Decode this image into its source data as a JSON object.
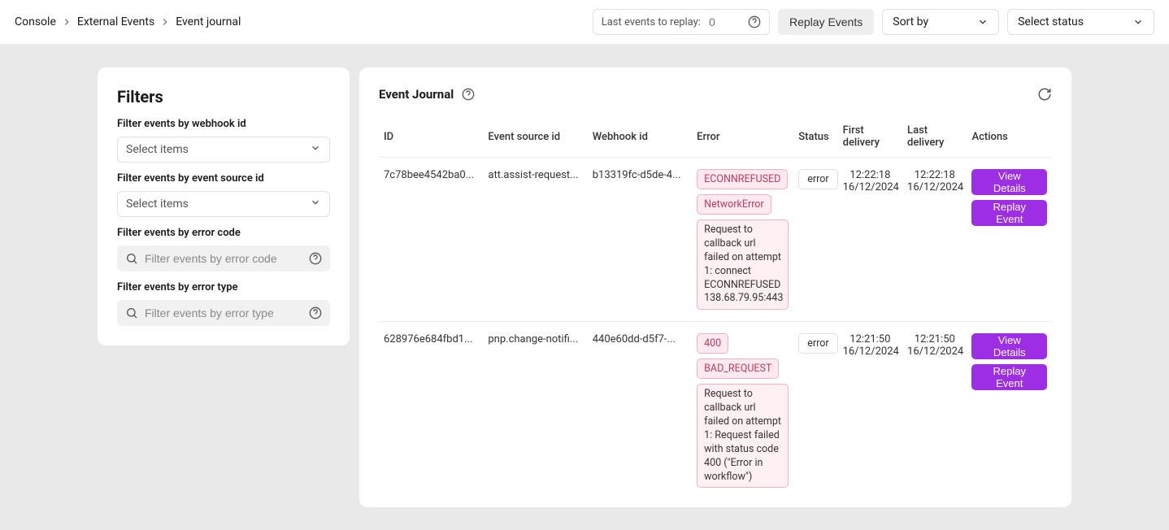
{
  "breadcrumbs": [
    "Console",
    "External Events",
    "Event journal"
  ],
  "topbar": {
    "replay_label": "Last events to replay:",
    "replay_value": "0",
    "replay_button": "Replay Events",
    "sort_by": "Sort by",
    "select_status": "Select status"
  },
  "filters": {
    "title": "Filters",
    "webhook_label": "Filter events by webhook id",
    "source_label": "Filter events by event source id",
    "error_code_label": "Filter events by error code",
    "error_type_label": "Filter events by error type",
    "select_items": "Select items",
    "error_code_placeholder": "Filter events by error code",
    "error_type_placeholder": "Filter events by error type"
  },
  "journal": {
    "title": "Event Journal",
    "columns": {
      "id": "ID",
      "source": "Event source id",
      "webhook": "Webhook id",
      "error": "Error",
      "status": "Status",
      "first": "First delivery",
      "last": "Last delivery",
      "actions": "Actions"
    },
    "rows": [
      {
        "id": "7c78bee4542ba0...",
        "source": "att.assist-request...",
        "webhook": "b13319fc-d5de-4...",
        "errors": [
          {
            "kind": "code",
            "text": "ECONNREFUSED"
          },
          {
            "kind": "code",
            "text": "NetworkError"
          },
          {
            "kind": "msg",
            "text": "Request to callback url failed on attempt 1: connect ECONNREFUSED 138.68.79.95:443"
          }
        ],
        "status": "error",
        "first": "12:22:18\n16/12/2024",
        "last": "12:22:18\n16/12/2024"
      },
      {
        "id": "628976e684fbd1...",
        "source": "pnp.change-notifi...",
        "webhook": "440e60dd-d5f7-...",
        "errors": [
          {
            "kind": "code",
            "text": "400"
          },
          {
            "kind": "code",
            "text": "BAD_REQUEST"
          },
          {
            "kind": "msg",
            "text": "Request to callback url failed on attempt 1: Request failed with status code 400 (\"Error in workflow\")"
          }
        ],
        "status": "error",
        "first": "12:21:50\n16/12/2024",
        "last": "12:21:50\n16/12/2024"
      }
    ],
    "actions": {
      "view": "View Details",
      "replay": "Replay Event"
    }
  }
}
